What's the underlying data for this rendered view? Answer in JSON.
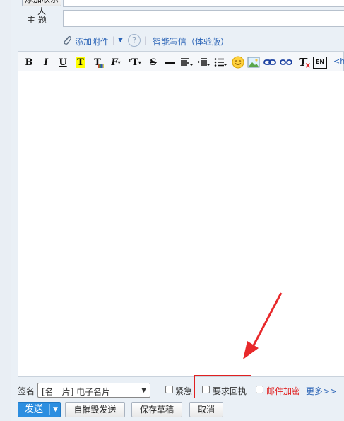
{
  "header": {
    "add_recipient_label": "添加联系人",
    "subject_label": "主 题",
    "subject_value": ""
  },
  "attach_row": {
    "add_attachment_label": "添加附件",
    "sep1": "|",
    "help_glyph": "?",
    "sep2": "|",
    "smart_write_label": "智能写信（体验版）"
  },
  "toolbar": {
    "bold": "B",
    "italic": "I",
    "underline": "U",
    "fontcolor": "T",
    "bgcolor": "T",
    "font": "F",
    "fontsize": "T",
    "strike": "S",
    "html_label": "<h"
  },
  "editor": {
    "content": ""
  },
  "signature": {
    "label": "签名",
    "selected": "[名　片] 电子名片"
  },
  "options": {
    "urgent_label": "紧急",
    "receipt_label": "要求回执",
    "encrypt_label": "邮件加密",
    "more_label": "更多>>"
  },
  "actions": {
    "send_label": "发送",
    "self_destruct_label": "自摧毁发送",
    "save_draft_label": "保存草稿",
    "cancel_label": "取消"
  },
  "colors": {
    "send_blue": "#2c8ee0",
    "link_blue": "#2a63b6",
    "encrypt_red": "#e02020",
    "arrow_red": "#e8292b"
  }
}
